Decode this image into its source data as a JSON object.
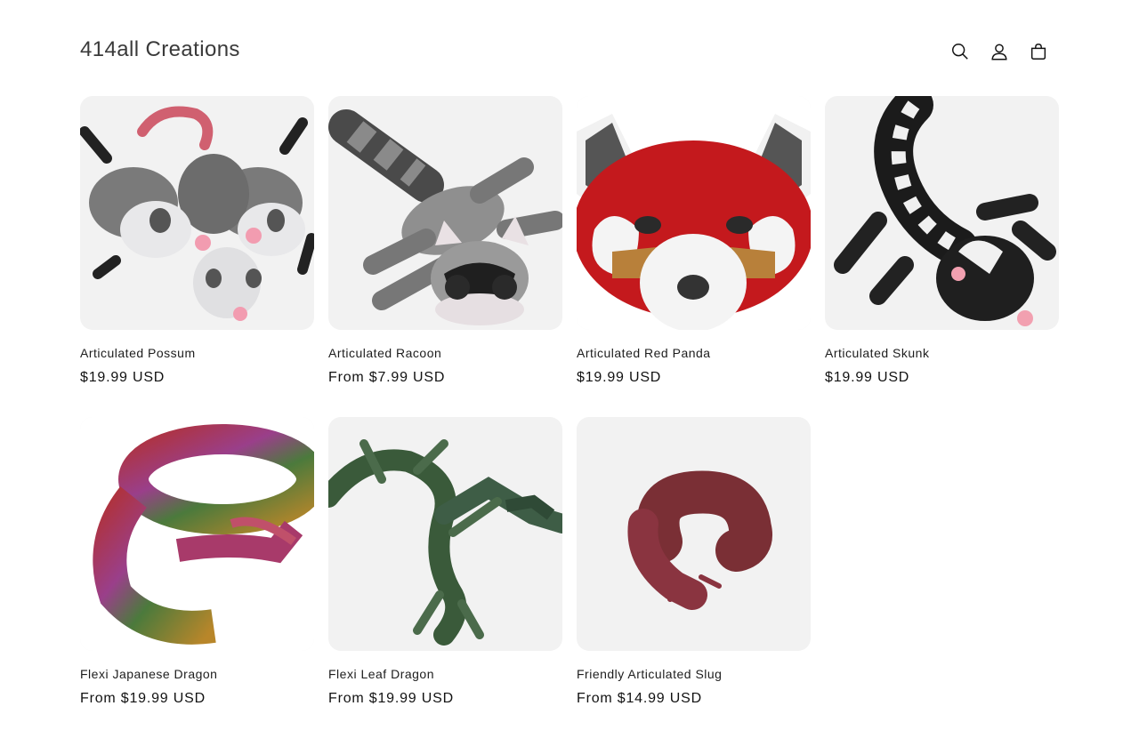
{
  "store": {
    "name": "414all Creations"
  },
  "header": {
    "icons": [
      "search-icon",
      "account-icon",
      "cart-icon"
    ]
  },
  "products": [
    {
      "title": "Articulated Possum",
      "price": "$19.99 USD",
      "image": "possum"
    },
    {
      "title": "Articulated Racoon",
      "price": "From $7.99 USD",
      "image": "racoon"
    },
    {
      "title": "Articulated Red Panda",
      "price": "$19.99 USD",
      "image": "red-panda"
    },
    {
      "title": "Articulated Skunk",
      "price": "$19.99 USD",
      "image": "skunk"
    },
    {
      "title": "Flexi Japanese Dragon",
      "price": "From $19.99 USD",
      "image": "japanese-dragon"
    },
    {
      "title": "Flexi Leaf Dragon",
      "price": "From $19.99 USD",
      "image": "leaf-dragon"
    },
    {
      "title": "Friendly Articulated Slug",
      "price": "From $14.99 USD",
      "image": "slug"
    }
  ],
  "colors": {
    "card_bg": "#f2f2f2",
    "text": "#121212"
  }
}
